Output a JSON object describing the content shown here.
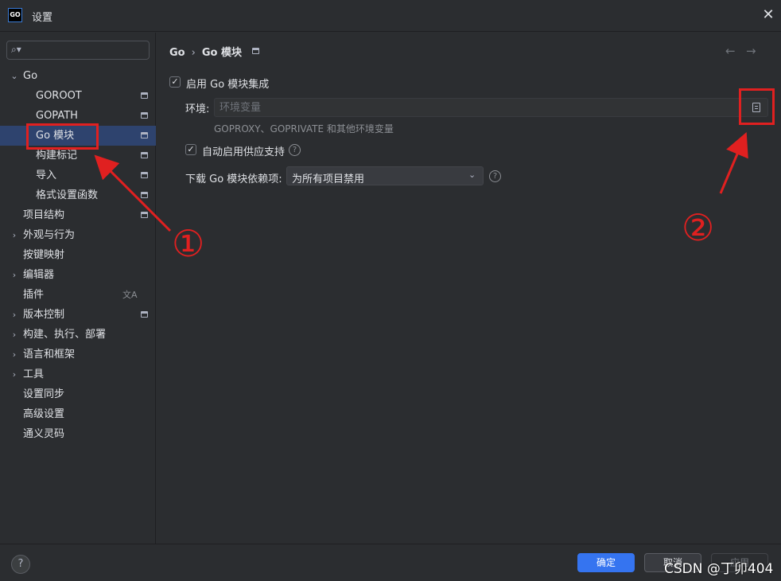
{
  "window": {
    "title": "设置",
    "logo_text": "GO"
  },
  "sidebar": {
    "search_placeholder": "",
    "items": [
      {
        "label": "Go",
        "expanded": true
      },
      {
        "label": "GOROOT"
      },
      {
        "label": "GOPATH"
      },
      {
        "label": "Go 模块",
        "selected": true
      },
      {
        "label": "构建标记"
      },
      {
        "label": "导入"
      },
      {
        "label": "格式设置函数"
      },
      {
        "label": "项目结构"
      },
      {
        "label": "外观与行为"
      },
      {
        "label": "按键映射"
      },
      {
        "label": "编辑器"
      },
      {
        "label": "插件"
      },
      {
        "label": "版本控制"
      },
      {
        "label": "构建、执行、部署"
      },
      {
        "label": "语言和框架"
      },
      {
        "label": "工具"
      },
      {
        "label": "设置同步"
      },
      {
        "label": "高级设置"
      },
      {
        "label": "通义灵码"
      }
    ]
  },
  "breadcrumb": {
    "parent": "Go",
    "separator": "›",
    "current": "Go 模块"
  },
  "settings": {
    "enable_integration": {
      "label": "启用 Go 模块集成",
      "checked": true
    },
    "env": {
      "label": "环境:",
      "placeholder": "环境变量",
      "value": ""
    },
    "env_hint": "GOPROXY、GOPRIVATE 和其他环境变量",
    "vendoring": {
      "label": "自动启用供应支持",
      "checked": true
    },
    "download_deps": {
      "label": "下载 Go 模块依赖项:",
      "selected": "为所有项目禁用"
    }
  },
  "footer": {
    "ok": "确定",
    "cancel": "取消",
    "apply": "应用"
  },
  "annotations": {
    "one": "①",
    "two": "②"
  },
  "watermark": "CSDN @丁卯404",
  "colors": {
    "accent": "#3574f0",
    "selection": "#2e436e",
    "annotation": "#e02020"
  }
}
